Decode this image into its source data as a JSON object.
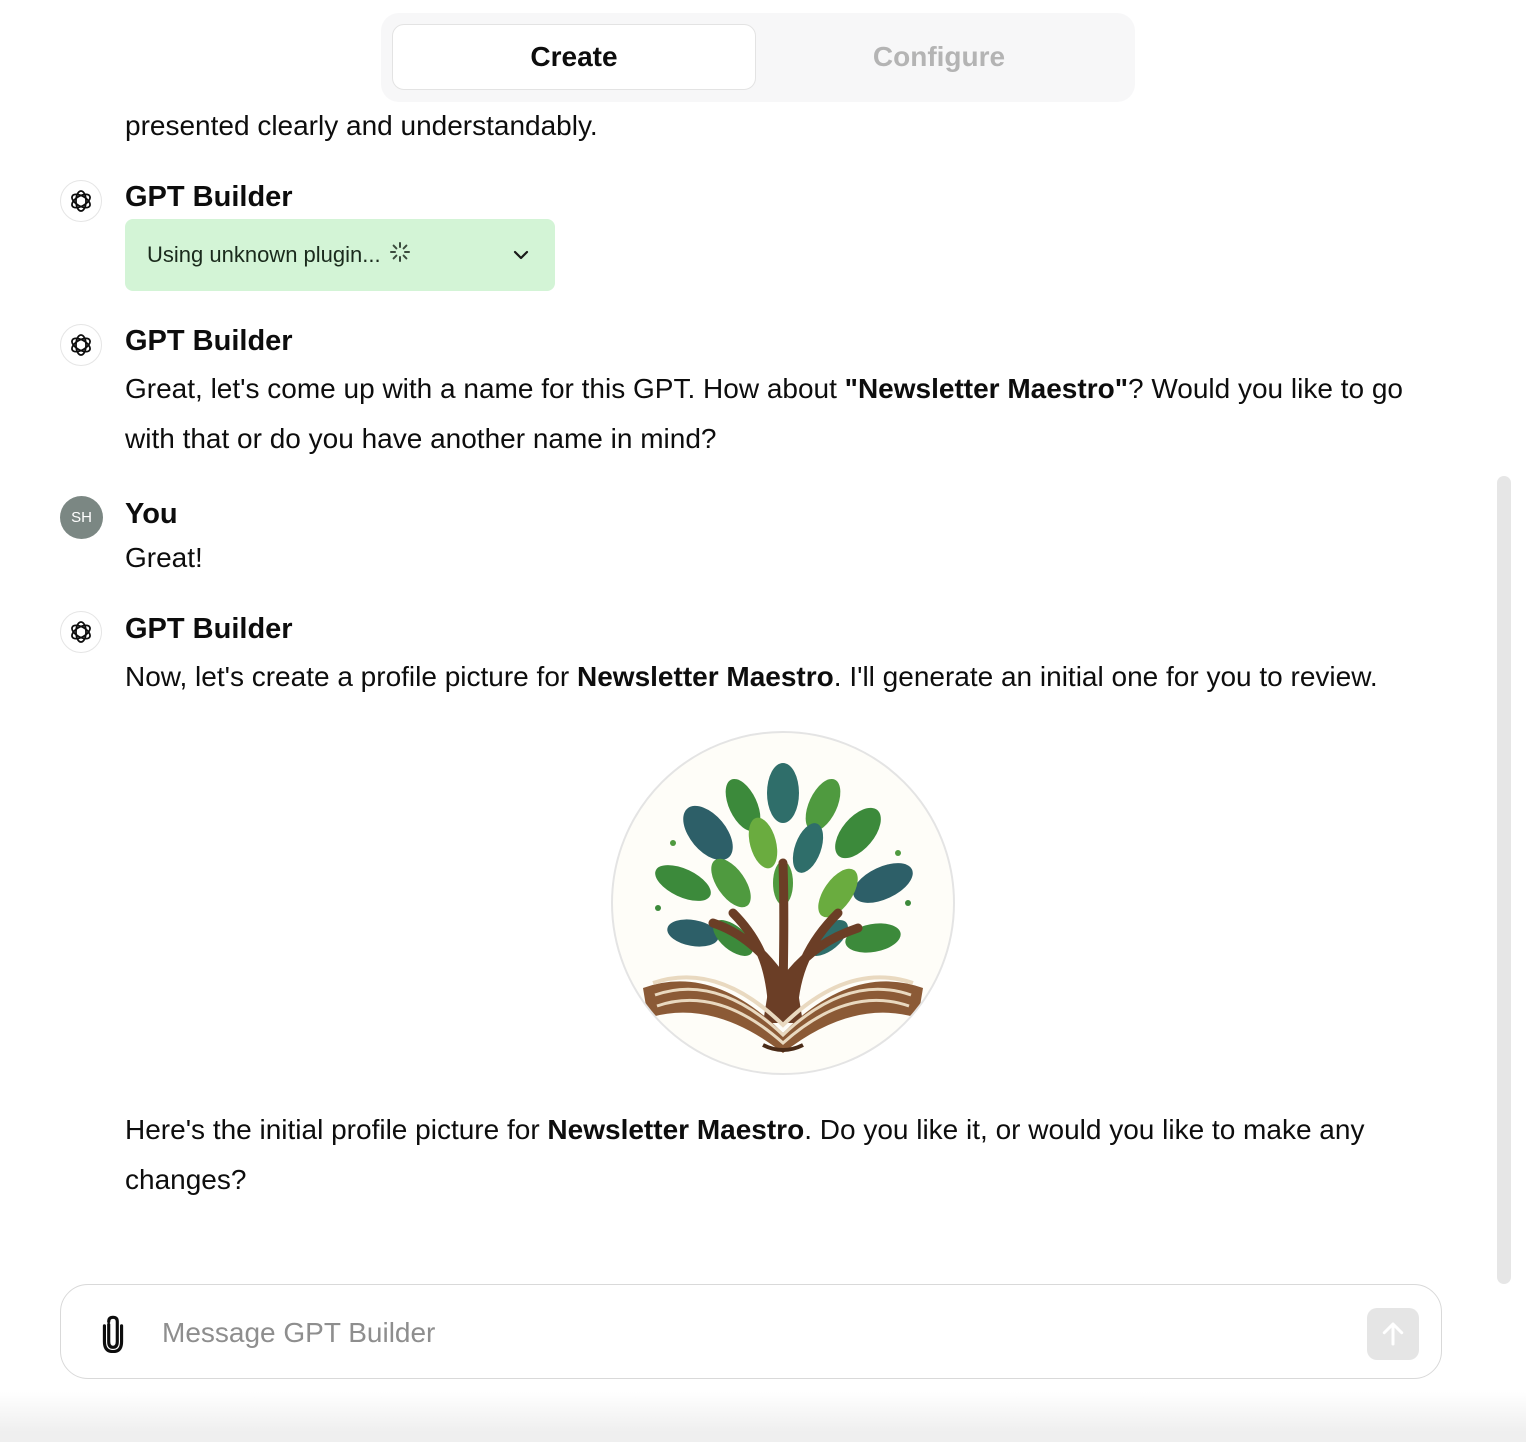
{
  "tabs": {
    "create": "Create",
    "configure": "Configure"
  },
  "messages": {
    "partial_top": "presented clearly and understandably.",
    "m1": {
      "author": "GPT Builder",
      "plugin_status": "Using unknown plugin..."
    },
    "m2": {
      "author": "GPT Builder",
      "pre": "Great, let's come up with a name for this GPT. How about ",
      "bold": "\"Newsletter Maestro\"",
      "post": "? Would you like to go with that or do you have another name in mind?"
    },
    "m3": {
      "author": "You",
      "avatar_initials": "SH",
      "text": "Great!"
    },
    "m4": {
      "author": "GPT Builder",
      "pre": "Now, let's create a profile picture for ",
      "bold": "Newsletter Maestro",
      "post": ". I'll generate an initial one for you to review.",
      "after_pre": "Here's the initial profile picture for ",
      "after_bold": "Newsletter Maestro",
      "after_post": ". Do you like it, or would you like to make any changes?"
    }
  },
  "composer": {
    "placeholder": "Message GPT Builder"
  },
  "icons": {
    "bot_avatar": "openai-logo-icon",
    "attach": "paperclip-icon",
    "send": "arrow-up-icon",
    "plugin_spinner": "spinner-icon",
    "plugin_toggle": "chevron-down-icon"
  },
  "colors": {
    "plugin_bg": "#d3f4d6",
    "user_avatar_bg": "#7b8783",
    "inactive_tab": "#b4b4b4"
  }
}
